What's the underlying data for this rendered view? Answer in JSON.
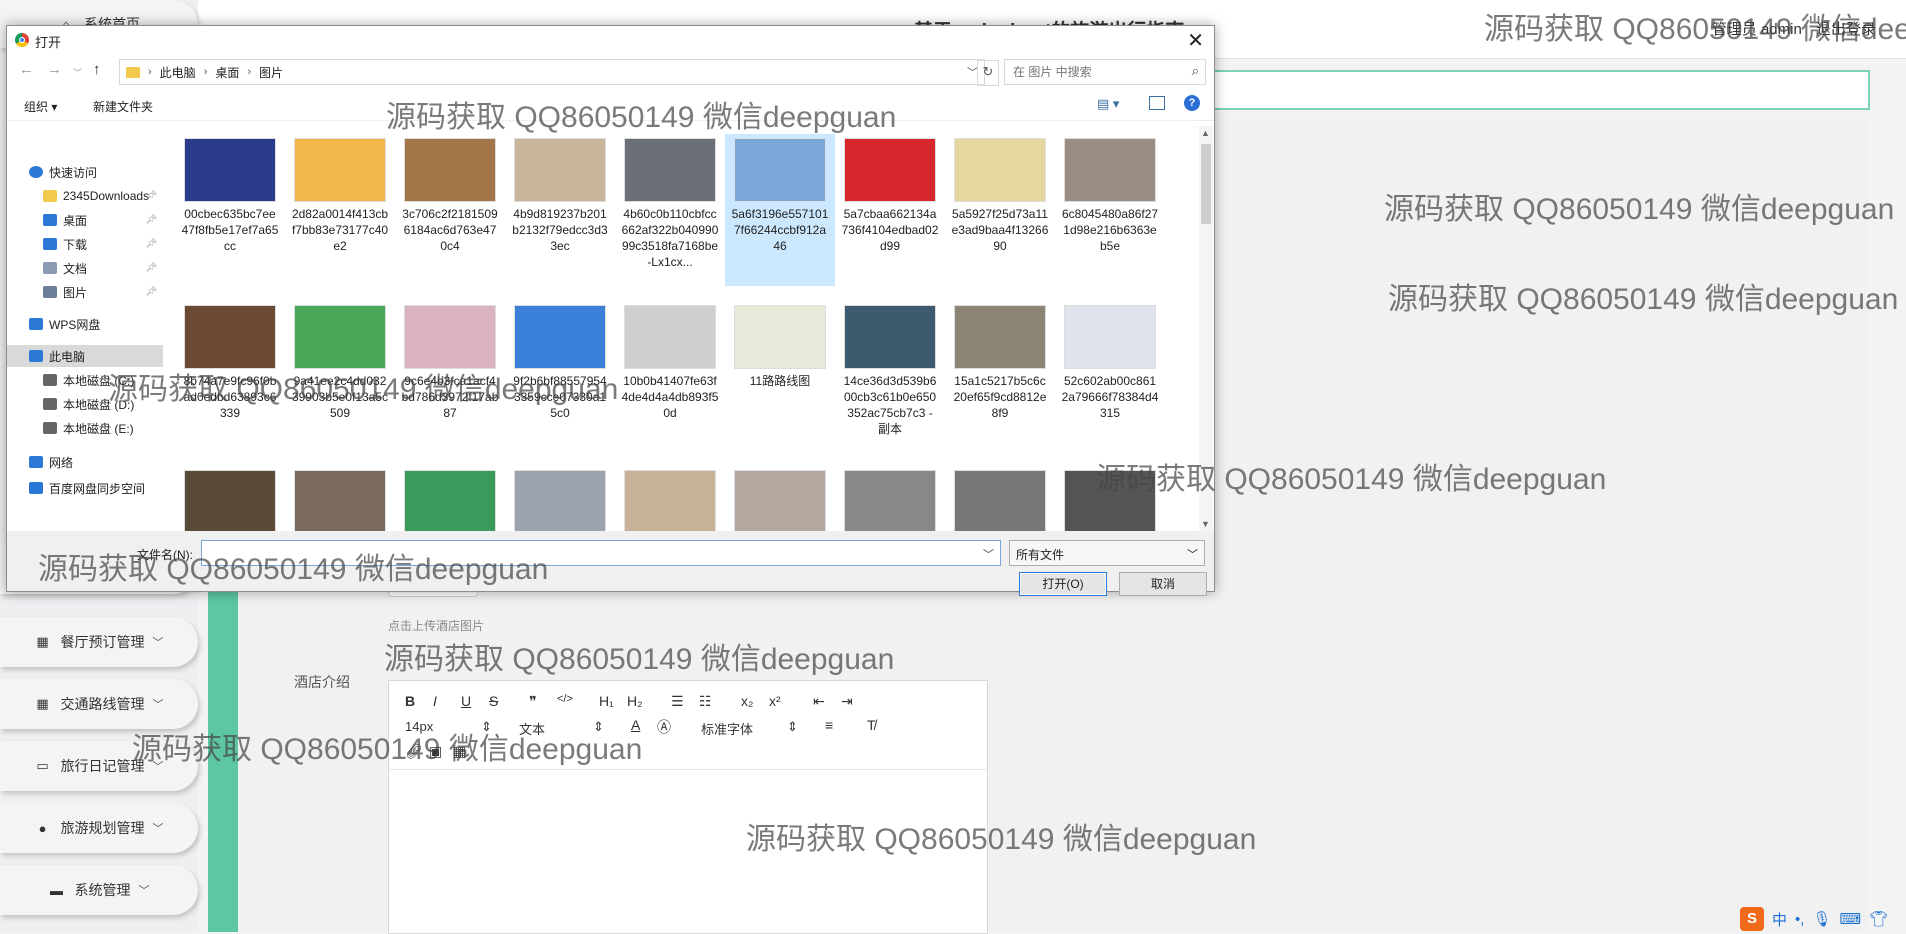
{
  "app": {
    "page_title": "基于springboot的旅游出行指南",
    "user_role": "管理员 admin",
    "logout": "退出登录"
  },
  "sidebar": {
    "items": [
      {
        "label": "系统首页"
      },
      {
        "label": "餐厅预订管理"
      },
      {
        "label": "交通路线管理"
      },
      {
        "label": "旅行日记管理"
      },
      {
        "label": "旅游规划管理"
      },
      {
        "label": "系统管理"
      }
    ]
  },
  "form": {
    "upload_hint": "点击上传酒店图片",
    "intro_label": "酒店介绍",
    "editor": {
      "bold": "B",
      "italic": "I",
      "underline": "U",
      "strike": "S",
      "quote": "❞",
      "code": "</>",
      "h1": "H₁",
      "h2": "H₂",
      "ol": "☰",
      "ul": "☷",
      "sub": "x₂",
      "sup": "x²",
      "outdent": "⇤",
      "indent": "⇥",
      "size": "14px",
      "font_type": "文本",
      "font_family": "标准字体",
      "align": "≡",
      "clear": "T̸"
    }
  },
  "ime": {
    "brand": "S",
    "lang": "中"
  },
  "dialog": {
    "title": "打开",
    "close": "✕",
    "breadcrumb": [
      "此电脑",
      "桌面",
      "图片"
    ],
    "search_placeholder": "在 图片 中搜索",
    "organize": "组织 ▾",
    "new_folder": "新建文件夹",
    "help": "?",
    "nav": [
      {
        "label": "快速访问",
        "icon": "star-icon",
        "pin": false
      },
      {
        "label": "2345Downloads",
        "icon": "folder-icon",
        "pin": true
      },
      {
        "label": "桌面",
        "icon": "desktop-icon",
        "pin": true
      },
      {
        "label": "下载",
        "icon": "download-icon",
        "pin": true
      },
      {
        "label": "文档",
        "icon": "document-icon",
        "pin": true
      },
      {
        "label": "图片",
        "icon": "picture-icon",
        "pin": true
      },
      {
        "label": "WPS网盘",
        "icon": "cloud-icon",
        "pin": false
      },
      {
        "label": "此电脑",
        "icon": "computer-icon",
        "pin": false
      },
      {
        "label": "本地磁盘 (C:)",
        "icon": "disk-icon",
        "pin": false
      },
      {
        "label": "本地磁盘 (D:)",
        "icon": "disk-icon",
        "pin": false
      },
      {
        "label": "本地磁盘 (E:)",
        "icon": "disk-icon",
        "pin": false
      },
      {
        "label": "网络",
        "icon": "network-icon",
        "pin": false
      },
      {
        "label": "百度网盘同步空间",
        "icon": "baidu-cloud-icon",
        "pin": false
      }
    ],
    "files": [
      {
        "name": "00cbec635bc7ee47f8fb5e17ef7a65cc",
        "color": "#2b3b8c"
      },
      {
        "name": "2d82a0014f413cbf7bb83e73177c40e2",
        "color": "#f2b64c"
      },
      {
        "name": "3c706c2f21815096184ac6d763e470c4",
        "color": "#a27649"
      },
      {
        "name": "4b9d819237b201b2132f79edcc3d33ec",
        "color": "#c9b59b"
      },
      {
        "name": "4b60c0b110cbfcc662af322b04099099c3518fa7168be-Lx1cx...",
        "color": "#6a6f78"
      },
      {
        "name": "5a6f3196e5571017f66244ccbf912a46",
        "color": "#7aa8d8"
      },
      {
        "name": "5a7cbaa662134a736f4104edbad02d99",
        "color": "#d8262d"
      },
      {
        "name": "5a5927f25d73a11e3ad9baa4f1326690",
        "color": "#e8d6a0"
      },
      {
        "name": "6c8045480a86f271d98e216b6363eb5e",
        "color": "#9a8e84"
      },
      {
        "name": "8b74a7e9fc96f0bad0edbd63893c6339",
        "color": "#6b4a33"
      },
      {
        "name": "9a41ee2c4dd03239903b5e0f13a5c509",
        "color": "#4aa85a"
      },
      {
        "name": "9c6e4b3fca1acf4bd786d3972f17ab87",
        "color": "#d9b3c0"
      },
      {
        "name": "9f2b6bf885579543359cce07330a15c0",
        "color": "#3a7fd8"
      },
      {
        "name": "10b0b41407fe63f4de4d4a4db893f50d",
        "color": "#cfcfcf"
      },
      {
        "name": "11路路线图",
        "color": "#e6ead8"
      },
      {
        "name": "14ce36d3d539b600cb3c61b0e650352ac75cb7c3 - 副本",
        "color": "#3d5a6e"
      },
      {
        "name": "15a1c5217b5c6c20ef65f9cd8812e8f9",
        "color": "#8c8576"
      },
      {
        "name": "52c602ab00c8612a79666f78384d4315",
        "color": "#dfe3ec"
      },
      {
        "name": "",
        "color": "#5a4a3a"
      },
      {
        "name": "",
        "color": "#7a6a5e"
      },
      {
        "name": "",
        "color": "#3b9a5b"
      },
      {
        "name": "",
        "color": "#9aa3ab"
      },
      {
        "name": "",
        "color": "#c8b29a"
      },
      {
        "name": "",
        "color": "#b6a7a0"
      },
      {
        "name": "",
        "color": "#888"
      },
      {
        "name": "",
        "color": "#777"
      },
      {
        "name": "",
        "color": "#555"
      }
    ],
    "filename_label": "文件名(N):",
    "filename_value": "",
    "filetype": "所有文件",
    "open_btn": "打开(O)",
    "cancel_btn": "取消"
  },
  "watermark": "源码获取 QQ86050149 微信deepguan"
}
